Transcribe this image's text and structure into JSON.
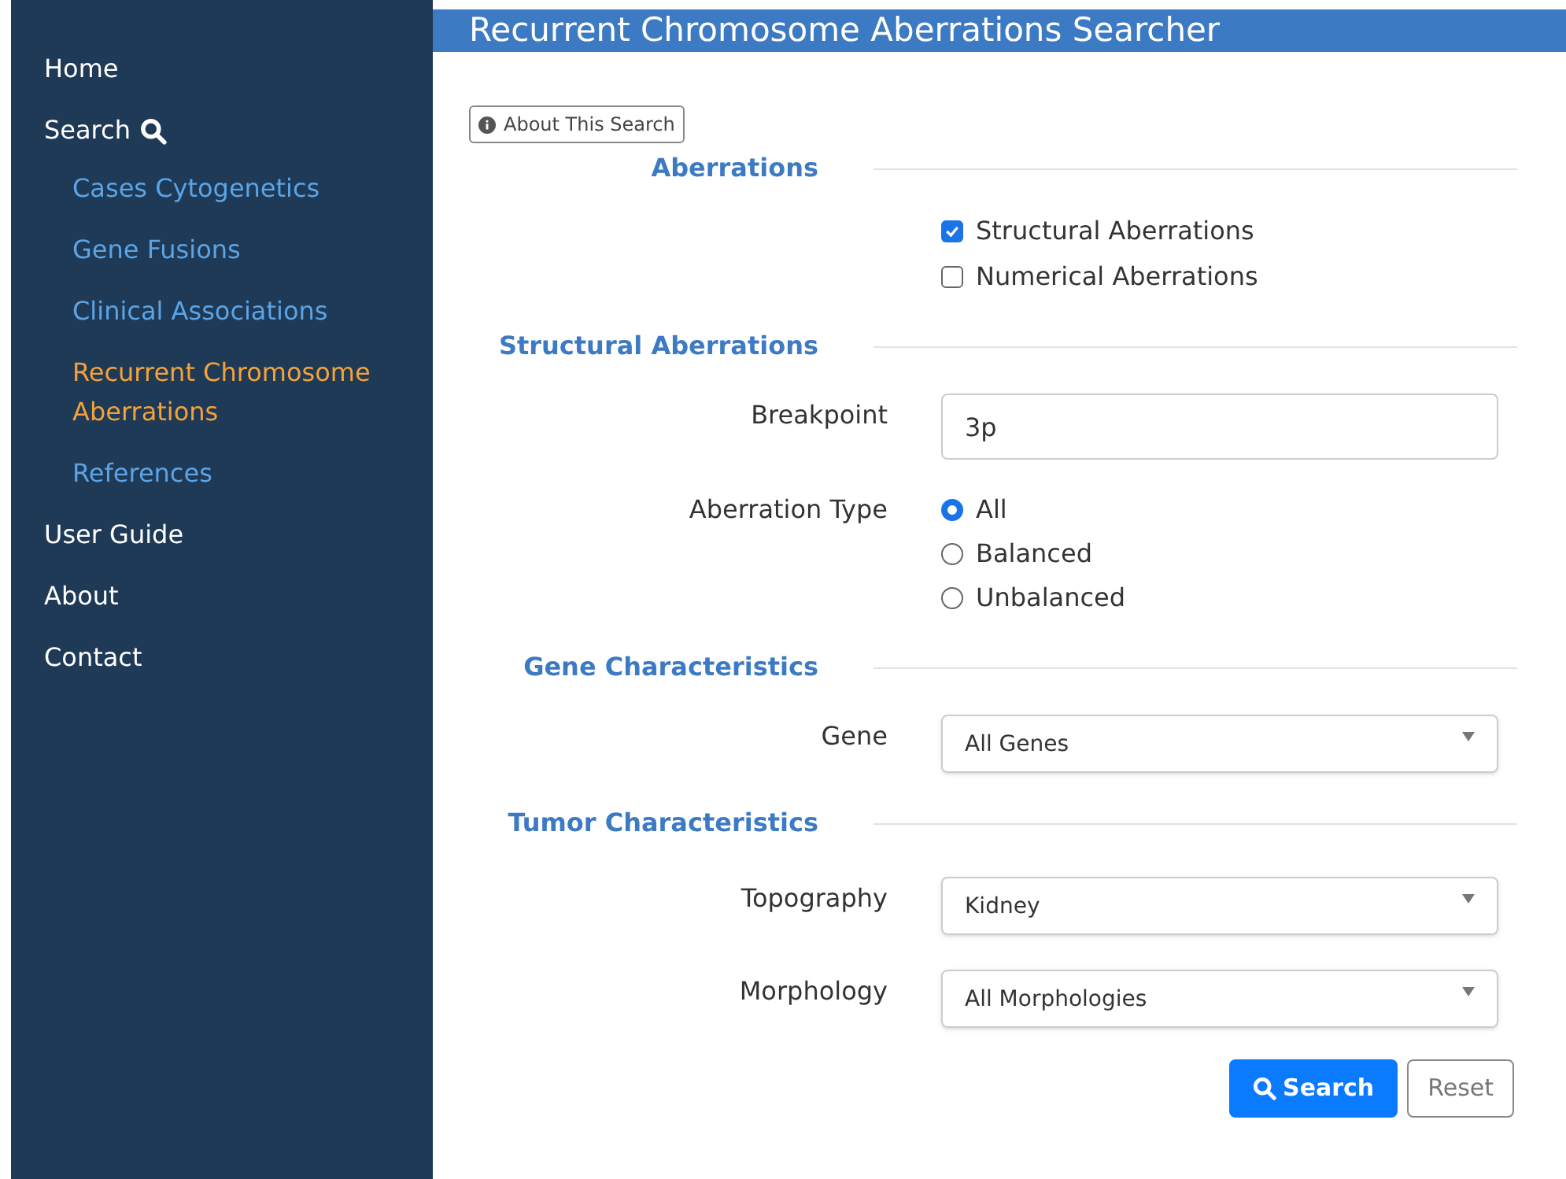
{
  "sidebar": {
    "items": [
      {
        "label": "Home",
        "kind": "link"
      },
      {
        "label": "Search",
        "kind": "search",
        "children": [
          {
            "label": "Cases Cytogenetics",
            "selected": false
          },
          {
            "label": "Gene Fusions",
            "selected": false
          },
          {
            "label": "Clinical Associations",
            "selected": false
          },
          {
            "label": "Recurrent Chromosome Aberrations",
            "selected": true
          },
          {
            "label": "References",
            "selected": false
          }
        ]
      },
      {
        "label": "User Guide",
        "kind": "link"
      },
      {
        "label": "About",
        "kind": "link"
      },
      {
        "label": "Contact",
        "kind": "link"
      }
    ]
  },
  "header": {
    "title": "Recurrent Chromosome Aberrations Searcher"
  },
  "about_button": "About This Search",
  "sections": [
    {
      "heading": "Aberrations",
      "fields": [
        {
          "kind": "checkboxes",
          "options": [
            {
              "label": "Structural Aberrations",
              "checked": true
            },
            {
              "label": "Numerical Aberrations",
              "checked": false
            }
          ]
        }
      ]
    },
    {
      "heading": "Structural Aberrations",
      "fields": [
        {
          "kind": "text",
          "label": "Breakpoint",
          "value": "3p"
        },
        {
          "kind": "radios",
          "label": "Aberration Type",
          "options": [
            {
              "label": "All",
              "selected": true
            },
            {
              "label": "Balanced",
              "selected": false
            },
            {
              "label": "Unbalanced",
              "selected": false
            }
          ]
        }
      ]
    },
    {
      "heading": "Gene Characteristics",
      "fields": [
        {
          "kind": "select",
          "label": "Gene",
          "value": "All Genes"
        }
      ]
    },
    {
      "heading": "Tumor Characteristics",
      "fields": [
        {
          "kind": "select",
          "label": "Topography",
          "value": "Kidney"
        },
        {
          "kind": "select",
          "label": "Morphology",
          "value": "All Morphologies"
        }
      ]
    }
  ],
  "buttons": [
    {
      "label": "Search",
      "kind": "primary"
    },
    {
      "label": "Reset",
      "kind": "secondary"
    }
  ]
}
